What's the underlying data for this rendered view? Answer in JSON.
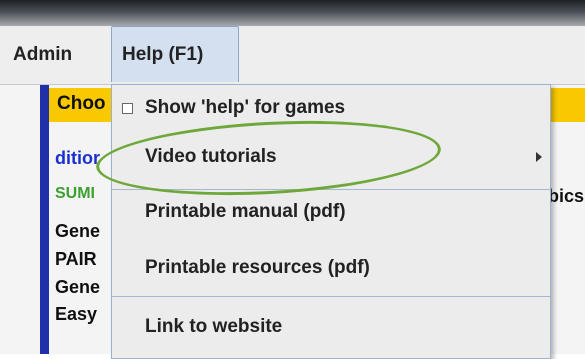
{
  "menubar": {
    "admin_label": "Admin",
    "help_label": "Help (F1)"
  },
  "background": {
    "choose_text": "Choo",
    "items": [
      "ditior",
      "SUMI",
      "Gene",
      "PAIR",
      "Gene",
      "Easy"
    ],
    "right_text": "bics"
  },
  "help_menu": {
    "items": [
      {
        "label": "Show 'help' for games"
      },
      {
        "label": "Video tutorials"
      },
      {
        "label": "Printable manual (pdf)"
      },
      {
        "label": "Printable resources (pdf)"
      },
      {
        "label": "Link to website"
      }
    ]
  },
  "colors": {
    "highlight": "#6fa83a",
    "menu_active": "#d4e0f0",
    "choose_bar": "#f8c800"
  }
}
